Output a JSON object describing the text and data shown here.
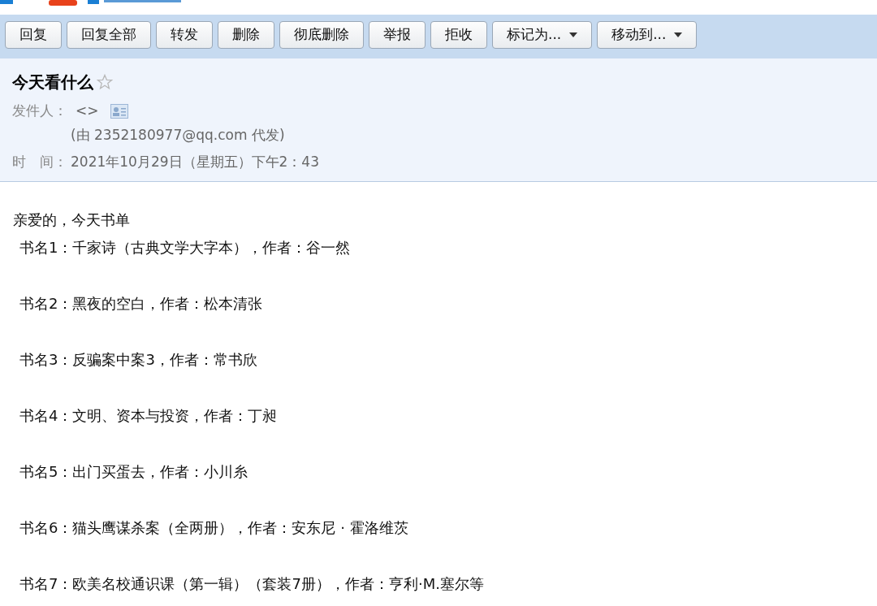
{
  "toolbar": {
    "buttons": [
      {
        "label": "回复",
        "kind": "plain"
      },
      {
        "label": "回复全部",
        "kind": "plain"
      },
      {
        "label": "转发",
        "kind": "plain"
      },
      {
        "label": "删除",
        "kind": "plain"
      },
      {
        "label": "彻底删除",
        "kind": "plain"
      },
      {
        "label": "举报",
        "kind": "plain"
      },
      {
        "label": "拒收",
        "kind": "plain"
      },
      {
        "label": "标记为...",
        "kind": "dropdown"
      },
      {
        "label": "移动到...",
        "kind": "dropdown"
      }
    ]
  },
  "message": {
    "subject": "今天看什么",
    "starred": false,
    "sender_label": "发件人：",
    "sender": "<>",
    "via": "(由 2352180977@qq.com 代发)",
    "time_label": "时　间：",
    "time": "2021年10月29日（星期五）下午2：43"
  },
  "body": {
    "greeting": "亲爱的，今天书单",
    "lines": [
      "书名1：千家诗（古典文学大字本），作者：谷一然",
      "书名2：黑夜的空白，作者：松本清张",
      "书名3：反骗案中案3，作者：常书欣",
      "书名4：文明、资本与投资，作者：丁昶",
      "书名5：出门买蛋去，作者：小川糸",
      "书名6：猫头鹰谋杀案（全两册），作者：安东尼 · 霍洛维茨",
      "书名7：欧美名校通识课（第一辑）（套装7册），作者：亨利·M.塞尔等"
    ]
  }
}
